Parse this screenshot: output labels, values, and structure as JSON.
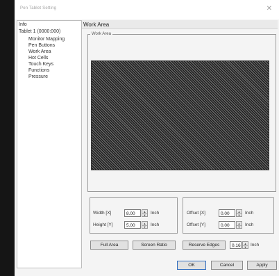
{
  "window": {
    "title": "Pen Tablet Setting",
    "close_glyph": "✕"
  },
  "tree": {
    "items": [
      {
        "label": "Info"
      },
      {
        "label": "Tablet 1 (0000:000)"
      },
      {
        "label": "Monitor Mapping"
      },
      {
        "label": "Pen Buttons"
      },
      {
        "label": "Work Area"
      },
      {
        "label": "Hot Cells"
      },
      {
        "label": "Touch Keys"
      },
      {
        "label": "Functions"
      },
      {
        "label": "Pressure"
      }
    ]
  },
  "panel": {
    "title": "Work Area",
    "group_label": "Work Area"
  },
  "size_group": {
    "width_label": "Width [X]",
    "width_value": "8.00",
    "width_unit": "Inch",
    "height_label": "Height [Y]",
    "height_value": "5.00",
    "height_unit": "Inch"
  },
  "offset_group": {
    "offset_x_label": "Offset [X]",
    "offset_x_value": "0.00",
    "offset_x_unit": "Inch",
    "offset_y_label": "Offset [Y]",
    "offset_y_value": "0.00",
    "offset_y_unit": "Inch"
  },
  "actions": {
    "full_area": "Full Area",
    "screen_ratio": "Screen Ratio",
    "reserve_edges": "Reserve Edges",
    "reserve_value": "0.16",
    "reserve_unit": "Inch"
  },
  "footer": {
    "ok": "OK",
    "cancel": "Cancel",
    "apply": "Apply"
  },
  "colors": {
    "dialog_bg": "#f4f4f4",
    "area_dark": "#1e1e1e",
    "area_light": "#6a6a6a"
  }
}
